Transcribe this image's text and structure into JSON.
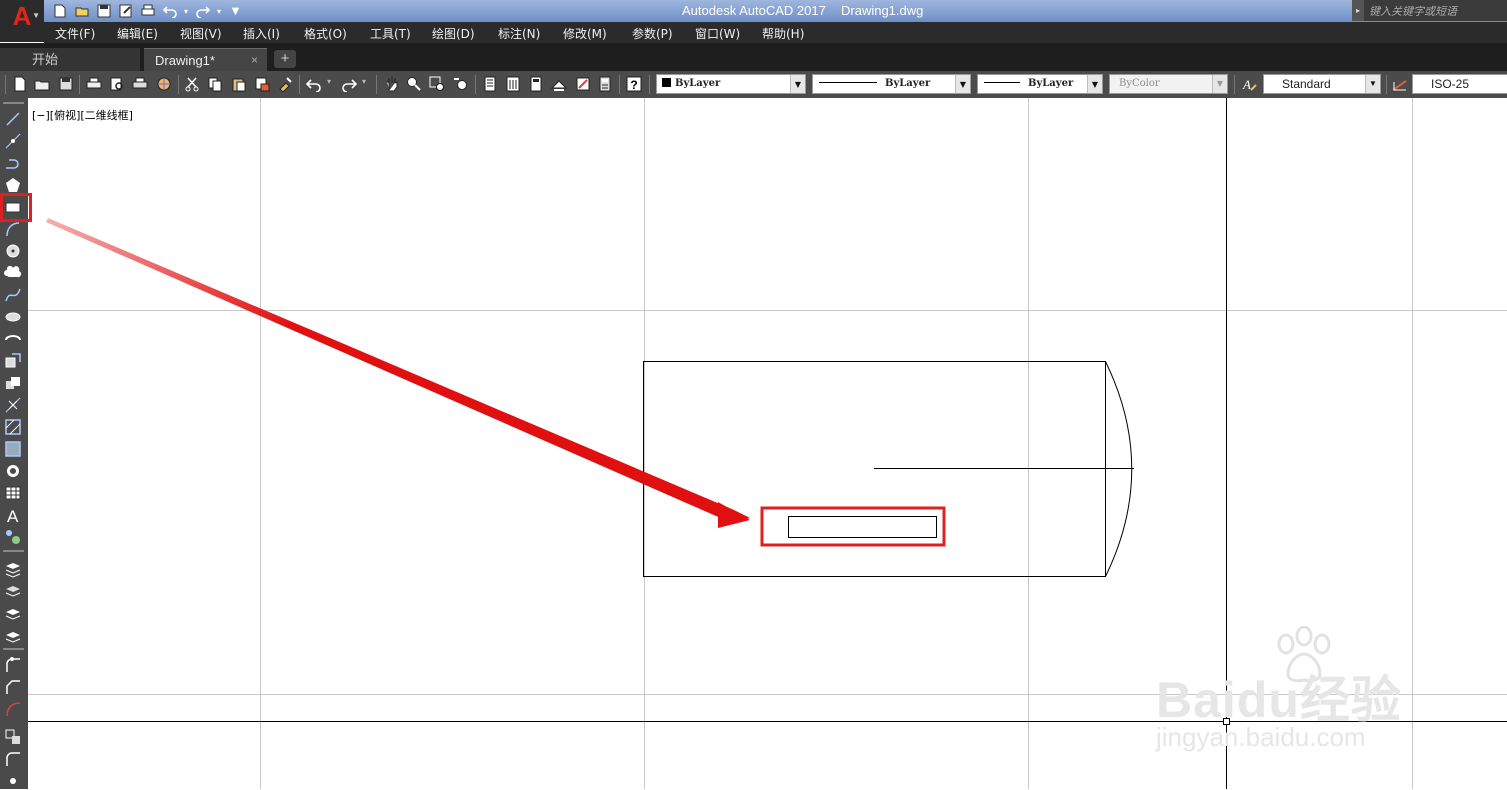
{
  "title_bar": {
    "app_logo": "A",
    "title": "Autodesk AutoCAD 2017",
    "file": "Drawing1.dwg",
    "search_placeholder": "键入关键字或短语"
  },
  "menu": [
    "文件(F)",
    "编辑(E)",
    "视图(V)",
    "插入(I)",
    "格式(O)",
    "工具(T)",
    "绘图(D)",
    "标注(N)",
    "修改(M)",
    "参数(P)",
    "窗口(W)",
    "帮助(H)"
  ],
  "tabs": {
    "start": "开始",
    "drawing": "Drawing1*",
    "close": "×",
    "add": "+"
  },
  "toolbar": {
    "layer_color": "ByLayer",
    "linetype": "ByLayer",
    "lineweight": "ByLayer",
    "plot_style": "ByColor",
    "text_style": "Standard",
    "dim_style": "ISO-25"
  },
  "viewport_label": "[−][俯视][二维线框]",
  "watermark": {
    "main": "Baidu经验",
    "url": "jingyan.baidu.com"
  },
  "colors": {
    "highlight": "#e02020",
    "arrow": "#e01010",
    "canvas": "#ffffff",
    "ui_dark": "#2b2b2b"
  }
}
